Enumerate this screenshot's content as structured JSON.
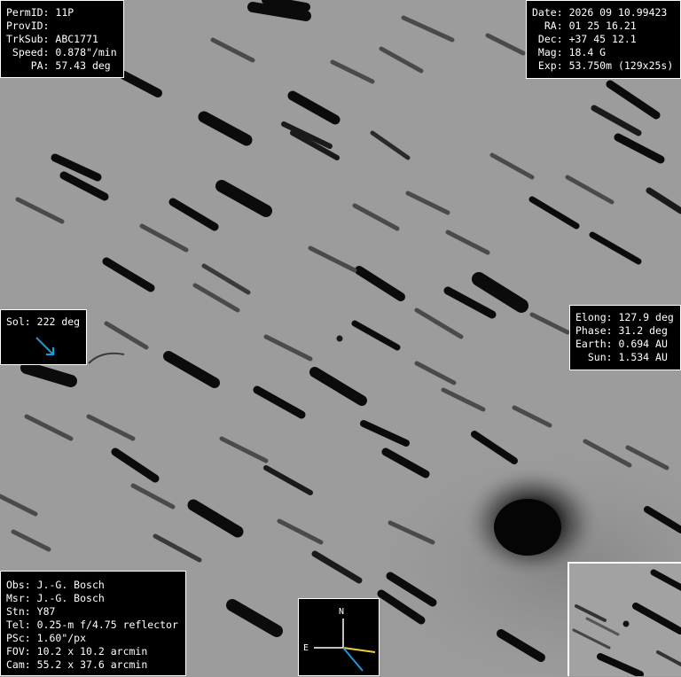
{
  "top_left": [
    {
      "label": "PermID:",
      "value": "11P"
    },
    {
      "label": "ProvID:",
      "value": ""
    },
    {
      "label": "TrkSub:",
      "value": "ABC1771"
    },
    {
      "label": " Speed:",
      "value": "0.878\"/min"
    },
    {
      "label": "    PA:",
      "value": "57.43 deg"
    }
  ],
  "top_right": [
    {
      "label": "Date:",
      "value": "2026 09 10.99423"
    },
    {
      "label": "  RA:",
      "value": "01 25 16.21"
    },
    {
      "label": " Dec:",
      "value": "+37 45 12.1"
    },
    {
      "label": " Mag:",
      "value": "18.4 G"
    },
    {
      "label": " Exp:",
      "value": "53.750m (129x25s)"
    }
  ],
  "sol": {
    "label": "Sol:",
    "value": "222 deg",
    "arrow_color": "#1a9ad8",
    "arrow_icon": "sun-direction-arrow-icon"
  },
  "right_mid": [
    {
      "label": "Elong:",
      "value": "127.9 deg"
    },
    {
      "label": "Phase:",
      "value": "31.2 deg"
    },
    {
      "label": "Earth:",
      "value": "0.694 AU"
    },
    {
      "label": "  Sun:",
      "value": "1.534 AU"
    }
  ],
  "bottom_left": [
    {
      "label": "Obs:",
      "value": "J.-G. Bosch"
    },
    {
      "label": "Msr:",
      "value": "J.-G. Bosch"
    },
    {
      "label": "Stn:",
      "value": "Y87"
    },
    {
      "label": "Tel:",
      "value": "0.25-m f/4.75 reflector"
    },
    {
      "label": "PSc:",
      "value": "1.60\"/px"
    },
    {
      "label": "FOV:",
      "value": "10.2 x 10.2 arcmin"
    },
    {
      "label": "Cam:",
      "value": "55.2 x 37.6 arcmin"
    }
  ],
  "compass": {
    "north": "N",
    "east": "E",
    "motion_color": "#e8d23a",
    "sun_color": "#1a9ad8"
  },
  "colors": {
    "background": "#9c9c9c",
    "streak": "#0b0b0b",
    "faint_streak": "#4a4a4a"
  }
}
